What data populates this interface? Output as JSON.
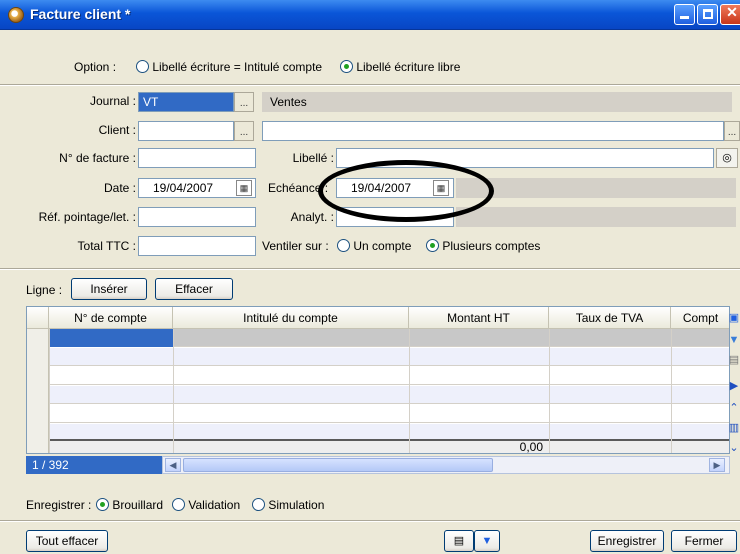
{
  "window": {
    "title": "Facture client *"
  },
  "option": {
    "label": "Option :",
    "choices": [
      {
        "label": "Libellé écriture = Intitulé compte",
        "selected": false
      },
      {
        "label": "Libellé écriture libre",
        "selected": true
      }
    ]
  },
  "form": {
    "journal": {
      "label": "Journal :",
      "value": "VT",
      "name": "Ventes"
    },
    "client": {
      "label": "Client :",
      "value": ""
    },
    "invoice_no": {
      "label": "N° de facture :",
      "value": ""
    },
    "libelle": {
      "label": "Libellé :",
      "value": ""
    },
    "date": {
      "label": "Date :",
      "value": "19/04/2007"
    },
    "echeance": {
      "label": "Echéance :",
      "value": "19/04/2007"
    },
    "ref": {
      "label": "Réf. pointage/let. :",
      "value": ""
    },
    "analyt": {
      "label": "Analyt. :",
      "value": ""
    },
    "total": {
      "label": "Total TTC :",
      "value": ""
    },
    "ventiler": {
      "label": "Ventiler sur :",
      "choices": [
        {
          "label": "Un compte",
          "selected": false
        },
        {
          "label": "Plusieurs comptes",
          "selected": true
        }
      ]
    }
  },
  "ligne": {
    "label": "Ligne :",
    "insert": "Insérer",
    "delete": "Effacer"
  },
  "grid": {
    "columns": [
      "N° de compte",
      "Intitulé du compte",
      "Montant HT",
      "Taux de TVA",
      "Compt"
    ],
    "rows": 6,
    "total_ht": "0,00",
    "record_counter": "1 / 392"
  },
  "enregistrer": {
    "label": "Enregistrer :",
    "choices": [
      {
        "label": "Brouillard",
        "selected": true
      },
      {
        "label": "Validation",
        "selected": false
      },
      {
        "label": "Simulation",
        "selected": false
      }
    ]
  },
  "buttons": {
    "clear_all": "Tout effacer",
    "save": "Enregistrer",
    "close": "Fermer"
  }
}
